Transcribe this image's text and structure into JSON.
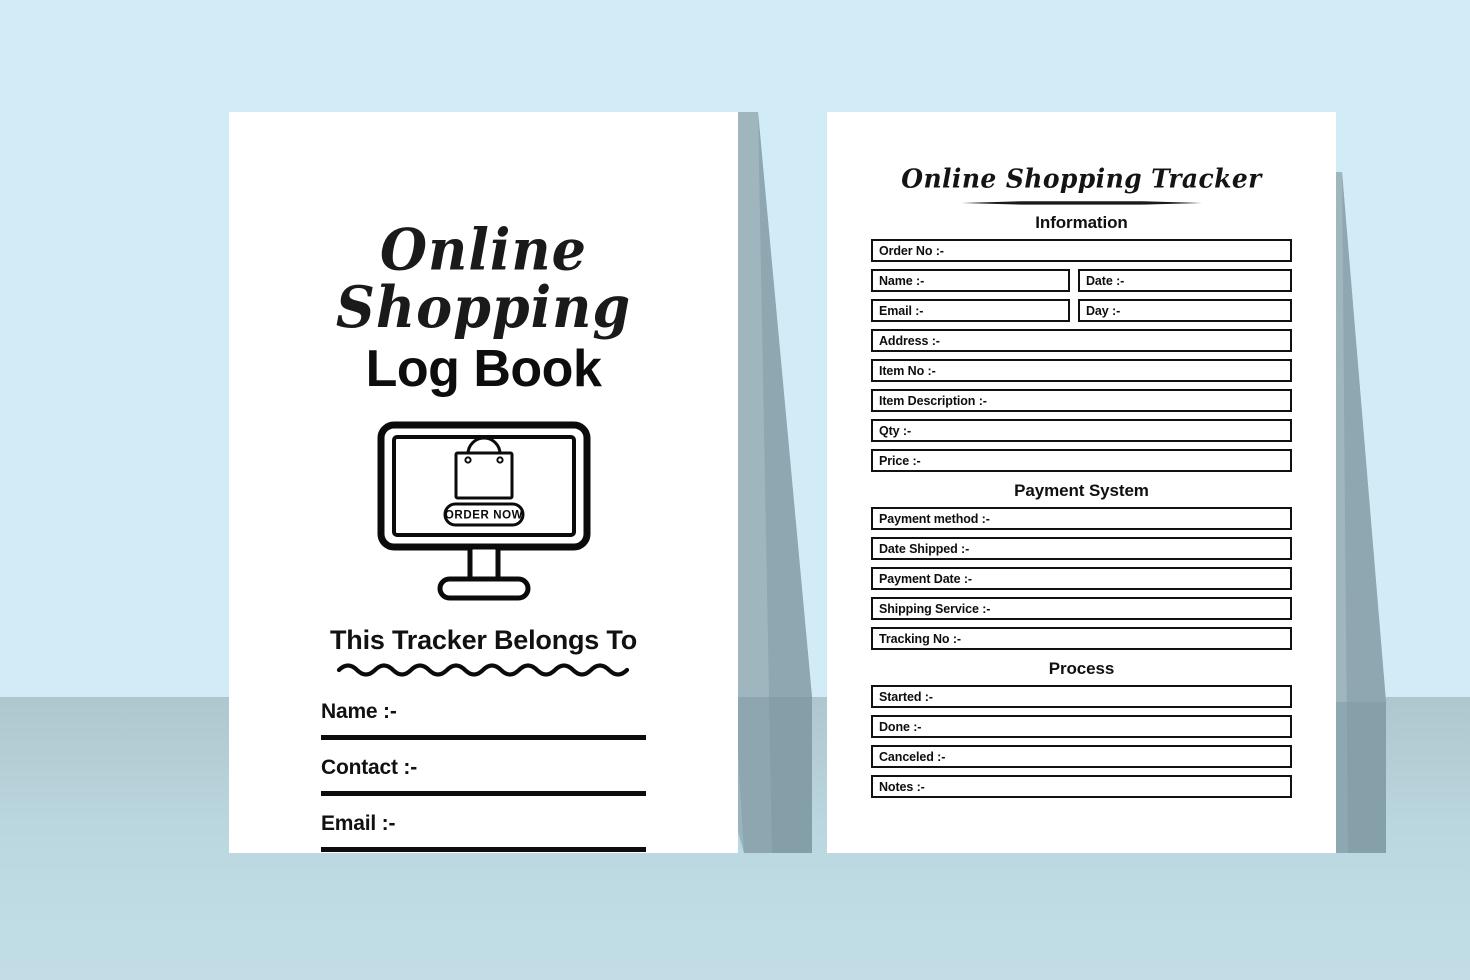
{
  "scene": {
    "background_color": "#d2ecf7",
    "floor_color": "#bad6de",
    "shadow_color": "#95aeb6"
  },
  "cover": {
    "title_script": "Online Shopping",
    "title_block": "Log Book",
    "illustration": {
      "name": "monitor-shopping-bag",
      "button_label": "ORDER NOW"
    },
    "belongs_heading": "This Tracker Belongs To",
    "fields": [
      {
        "label": "Name :-"
      },
      {
        "label": "Contact :-"
      },
      {
        "label": "Email :-"
      }
    ]
  },
  "inside": {
    "title": "Online Shopping Tracker",
    "sections": [
      {
        "heading": "Information",
        "rows": [
          {
            "type": "full",
            "cells": [
              {
                "label": "Order No :-",
                "shaded": false
              }
            ]
          },
          {
            "type": "split",
            "cells": [
              {
                "label": "Name :-",
                "shaded": false
              },
              {
                "label": "Date :-",
                "shaded": false
              }
            ]
          },
          {
            "type": "split",
            "cells": [
              {
                "label": "Email :-",
                "shaded": false
              },
              {
                "label": "Day :-",
                "shaded": false
              }
            ]
          },
          {
            "type": "full",
            "cells": [
              {
                "label": "Address :-",
                "shaded": true
              }
            ]
          },
          {
            "type": "full",
            "cells": [
              {
                "label": "Item No :-",
                "shaded": true
              }
            ]
          },
          {
            "type": "full",
            "cells": [
              {
                "label": "Item Description :-",
                "shaded": false
              }
            ]
          },
          {
            "type": "full",
            "cells": [
              {
                "label": "Qty :-",
                "shaded": false
              }
            ]
          },
          {
            "type": "full",
            "cells": [
              {
                "label": "Price :-",
                "shaded": false
              }
            ]
          }
        ]
      },
      {
        "heading": "Payment System",
        "rows": [
          {
            "type": "full",
            "cells": [
              {
                "label": "Payment method :-",
                "shaded": true
              }
            ]
          },
          {
            "type": "full",
            "cells": [
              {
                "label": "Date Shipped :-",
                "shaded": true
              }
            ]
          },
          {
            "type": "full",
            "cells": [
              {
                "label": "Payment Date :-",
                "shaded": true
              }
            ]
          },
          {
            "type": "full",
            "cells": [
              {
                "label": "Shipping Service :-",
                "shaded": true
              }
            ]
          },
          {
            "type": "full",
            "cells": [
              {
                "label": "Tracking No :-",
                "shaded": true
              }
            ]
          }
        ]
      },
      {
        "heading": "Process",
        "rows": [
          {
            "type": "full",
            "cells": [
              {
                "label": "Started :-",
                "shaded": true
              }
            ]
          },
          {
            "type": "full",
            "cells": [
              {
                "label": "Done :-",
                "shaded": true
              }
            ]
          },
          {
            "type": "full",
            "cells": [
              {
                "label": "Canceled :-",
                "shaded": true
              }
            ]
          },
          {
            "type": "full",
            "cells": [
              {
                "label": "Notes :-",
                "shaded": true
              }
            ]
          }
        ]
      }
    ]
  }
}
